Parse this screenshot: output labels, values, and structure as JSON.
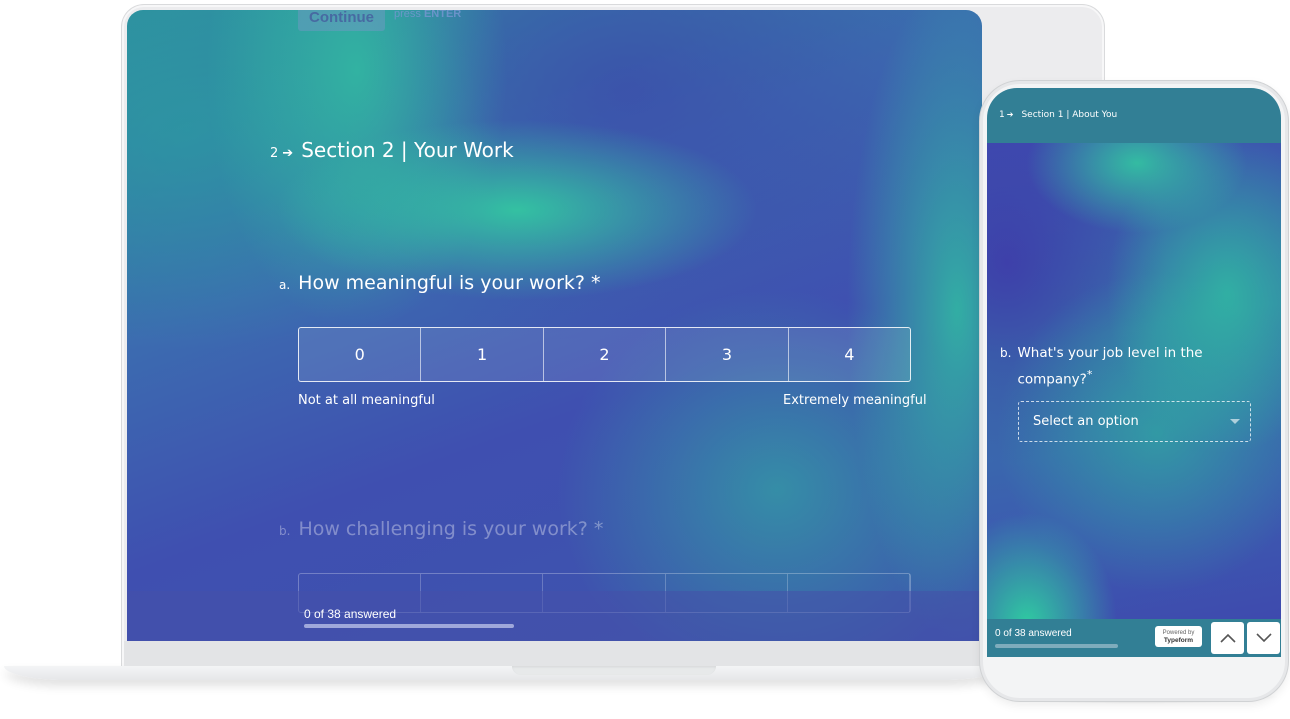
{
  "laptop": {
    "continue_button": "Continue",
    "press_hint": "press",
    "press_key": "ENTER",
    "section": {
      "number": "2",
      "arrow": "➔",
      "title": "Section 2 | Your Work"
    },
    "questions": [
      {
        "letter": "a.",
        "text": "How meaningful is your work? *",
        "scale": [
          "0",
          "1",
          "2",
          "3",
          "4"
        ],
        "label_low": "Not at all meaningful",
        "label_high": "Extremely meaningful"
      },
      {
        "letter": "b.",
        "text": "How challenging is your work? *"
      }
    ],
    "progress": {
      "text": "0 of 38 answered",
      "answered": 0,
      "total": 38
    }
  },
  "phone": {
    "section": {
      "number": "1",
      "arrow": "➔",
      "title": "Section 1 | About You"
    },
    "question": {
      "letter": "b.",
      "text": "What's your job level in the company?",
      "required_mark": "*"
    },
    "select": {
      "placeholder": "Select an option"
    },
    "progress": {
      "text": "0 of 38 answered",
      "answered": 0,
      "total": 38
    },
    "powered_by": {
      "line1": "Powered by",
      "brand": "Typeform"
    },
    "nav": {
      "up_icon": "chevron-up",
      "down_icon": "chevron-down"
    }
  },
  "colors": {
    "header_teal": "#327f95",
    "background_indigo": "#3f4fb0",
    "accent_green": "#32d2a0"
  }
}
